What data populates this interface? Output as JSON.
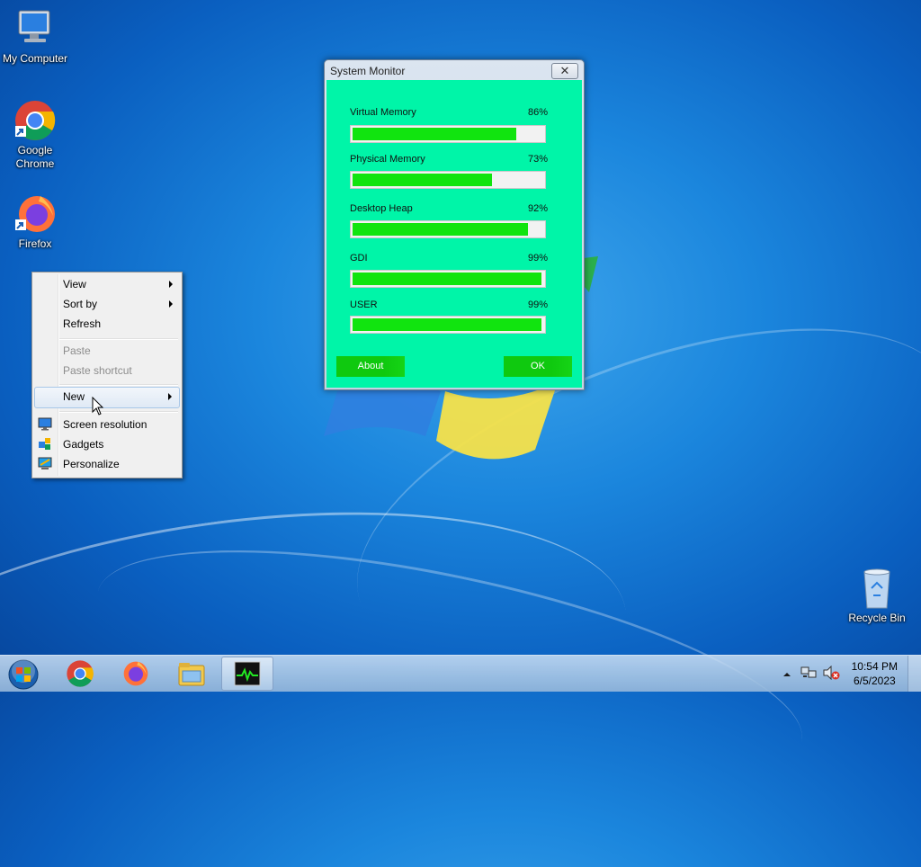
{
  "desktop": {
    "icons": [
      {
        "label": "My Computer"
      },
      {
        "label": "Google Chrome"
      },
      {
        "label": "Firefox"
      },
      {
        "label": "Recycle Bin"
      }
    ]
  },
  "context_menu": {
    "items": [
      {
        "label": "View",
        "has_submenu": true,
        "enabled": true
      },
      {
        "label": "Sort by",
        "has_submenu": true,
        "enabled": true
      },
      {
        "label": "Refresh",
        "has_submenu": false,
        "enabled": true
      },
      {
        "label": "Paste",
        "has_submenu": false,
        "enabled": false
      },
      {
        "label": "Paste shortcut",
        "has_submenu": false,
        "enabled": false
      },
      {
        "label": "New",
        "has_submenu": true,
        "enabled": true,
        "highlighted": true
      },
      {
        "label": "Screen resolution",
        "icon": "monitor-icon",
        "enabled": true
      },
      {
        "label": "Gadgets",
        "icon": "gadgets-icon",
        "enabled": true
      },
      {
        "label": "Personalize",
        "icon": "personalize-icon",
        "enabled": true
      }
    ]
  },
  "system_monitor": {
    "title": "System Monitor",
    "meters": [
      {
        "label": "Virtual Memory",
        "percent_text": "86%",
        "value": 86
      },
      {
        "label": "Physical Memory",
        "percent_text": "73%",
        "value": 73
      },
      {
        "label": "Desktop Heap",
        "percent_text": "92%",
        "value": 92
      },
      {
        "label": "GDI",
        "percent_text": "99%",
        "value": 99
      },
      {
        "label": "USER",
        "percent_text": "99%",
        "value": 99
      }
    ],
    "about_label": "About",
    "ok_label": "OK",
    "bar_color": "#11e40f",
    "background_color": "#00f5a8"
  },
  "taskbar": {
    "pinned": [
      {
        "icon": "start-orb-icon"
      },
      {
        "icon": "chrome-icon"
      },
      {
        "icon": "firefox-icon"
      },
      {
        "icon": "explorer-icon"
      },
      {
        "icon": "system-monitor-icon"
      }
    ],
    "clock": {
      "time": "10:54 PM",
      "date": "6/5/2023"
    }
  }
}
